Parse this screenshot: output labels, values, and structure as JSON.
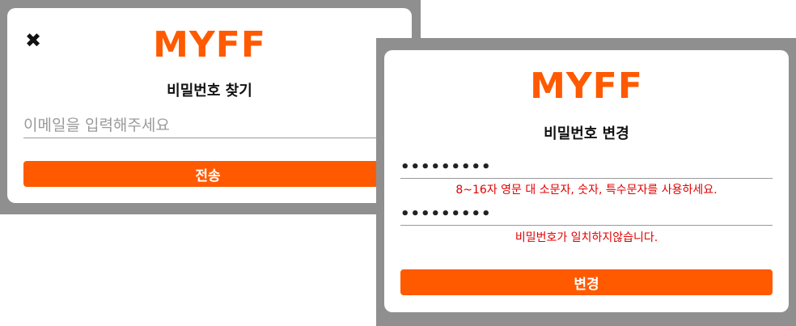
{
  "find_password": {
    "logo": "MYFF",
    "close_icon": "✖",
    "title": "비밀번호 찾기",
    "email_placeholder": "이메일을 입력해주세요",
    "submit_label": "전송"
  },
  "change_password": {
    "logo": "MYFF",
    "title": "비밀번호 변경",
    "password_value": "•••••••••",
    "password_error": "8~16자 영문 대 소문자, 숫자, 특수문자를 사용하세요.",
    "confirm_value": "•••••••••",
    "confirm_error": "비밀번호가 일치하지않습니다.",
    "submit_label": "변경"
  },
  "colors": {
    "accent": "#ff5a00",
    "error": "#e00000",
    "backdrop": "#8f8f8f"
  }
}
